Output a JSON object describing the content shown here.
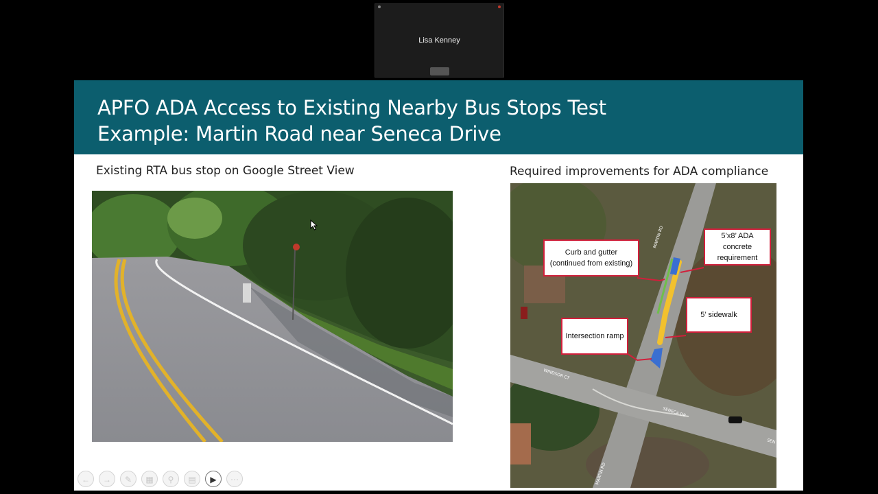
{
  "participant": {
    "name": "Lisa Kenney"
  },
  "slide": {
    "title_line1": "APFO ADA Access to Existing Nearby Bus Stops Test",
    "title_line2": "Example: Martin Road near Seneca Drive",
    "left_caption": "Existing RTA bus stop on Google Street View",
    "right_caption": "Required improvements for ADA compliance",
    "map_labels": {
      "curb": "Curb and gutter (continued from existing)",
      "ada_pad": "5’x8’ ADA concrete requirement",
      "sidewalk": "5’ sidewalk",
      "ramp": "Intersection ramp"
    },
    "map_street_labels": [
      "MARTIN RD",
      "WINDSOR CT",
      "SENECA DR",
      "MARTIN RD",
      "SEN"
    ]
  },
  "colors": {
    "header_bg": "#0c5e6e",
    "label_border": "#d11f3b",
    "sidewalk": "#f2c12e",
    "ada_pad": "#3a6fd1",
    "curb": "#6fbf4a"
  },
  "toolbar": {
    "buttons": [
      {
        "icon": "previous-slide-icon"
      },
      {
        "icon": "next-slide-icon"
      },
      {
        "icon": "pen-icon"
      },
      {
        "icon": "slides-grid-icon"
      },
      {
        "icon": "zoom-icon"
      },
      {
        "icon": "subtitles-icon"
      },
      {
        "icon": "camera-icon"
      },
      {
        "icon": "more-icon"
      }
    ]
  }
}
